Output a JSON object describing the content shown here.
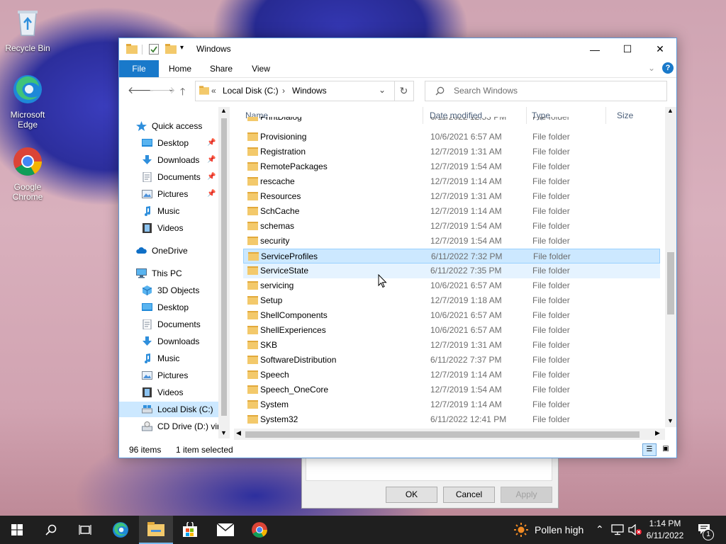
{
  "desktop": {
    "icons": [
      {
        "label": "Recycle Bin"
      },
      {
        "label": "Microsoft Edge"
      },
      {
        "label": "Google Chrome"
      }
    ]
  },
  "dialog": {
    "ok_label": "OK",
    "cancel_label": "Cancel",
    "apply_label": "Apply"
  },
  "window": {
    "title": "Windows",
    "controls": {
      "minimize": "—",
      "maximize": "☐",
      "close": "✕"
    }
  },
  "ribbon": {
    "tabs": [
      "File",
      "Home",
      "Share",
      "View"
    ],
    "help": "?"
  },
  "address": {
    "overflow": "«",
    "crumbs": [
      "Local Disk (C:)",
      "Windows"
    ],
    "separator": "›"
  },
  "search": {
    "placeholder": "Search Windows"
  },
  "sidebar": {
    "items": [
      {
        "label": "Quick access",
        "icon": "star-icon"
      },
      {
        "label": "Desktop",
        "icon": "desktop-icon"
      },
      {
        "label": "Downloads",
        "icon": "download-icon"
      },
      {
        "label": "Documents",
        "icon": "document-icon"
      },
      {
        "label": "Pictures",
        "icon": "picture-icon"
      },
      {
        "label": "Music",
        "icon": "music-icon"
      },
      {
        "label": "Videos",
        "icon": "video-icon"
      },
      {
        "label": "OneDrive",
        "icon": "cloud-icon"
      },
      {
        "label": "This PC",
        "icon": "computer-icon"
      },
      {
        "label": "3D Objects",
        "icon": "cube-icon"
      },
      {
        "label": "Desktop",
        "icon": "desktop-icon"
      },
      {
        "label": "Documents",
        "icon": "document-icon"
      },
      {
        "label": "Downloads",
        "icon": "download-icon"
      },
      {
        "label": "Music",
        "icon": "music-icon"
      },
      {
        "label": "Pictures",
        "icon": "picture-icon"
      },
      {
        "label": "Videos",
        "icon": "video-icon"
      },
      {
        "label": "Local Disk (C:)",
        "icon": "drive-icon"
      },
      {
        "label": "CD Drive (D:) virt",
        "icon": "cd-drive-icon"
      }
    ]
  },
  "columns": [
    "Name",
    "Date modified",
    "Type",
    "Size"
  ],
  "files": [
    {
      "name": "PrintDialog",
      "date": "6/11/2022 12:53 PM",
      "type": "File folder"
    },
    {
      "name": "Provisioning",
      "date": "10/6/2021 6:57 AM",
      "type": "File folder"
    },
    {
      "name": "Registration",
      "date": "12/7/2019 1:31 AM",
      "type": "File folder"
    },
    {
      "name": "RemotePackages",
      "date": "12/7/2019 1:54 AM",
      "type": "File folder"
    },
    {
      "name": "rescache",
      "date": "12/7/2019 1:14 AM",
      "type": "File folder"
    },
    {
      "name": "Resources",
      "date": "12/7/2019 1:31 AM",
      "type": "File folder"
    },
    {
      "name": "SchCache",
      "date": "12/7/2019 1:14 AM",
      "type": "File folder"
    },
    {
      "name": "schemas",
      "date": "12/7/2019 1:54 AM",
      "type": "File folder"
    },
    {
      "name": "security",
      "date": "12/7/2019 1:54 AM",
      "type": "File folder"
    },
    {
      "name": "ServiceProfiles",
      "date": "6/11/2022 7:32 PM",
      "type": "File folder"
    },
    {
      "name": "ServiceState",
      "date": "6/11/2022 7:35 PM",
      "type": "File folder"
    },
    {
      "name": "servicing",
      "date": "10/6/2021 6:57 AM",
      "type": "File folder"
    },
    {
      "name": "Setup",
      "date": "12/7/2019 1:18 AM",
      "type": "File folder"
    },
    {
      "name": "ShellComponents",
      "date": "10/6/2021 6:57 AM",
      "type": "File folder"
    },
    {
      "name": "ShellExperiences",
      "date": "10/6/2021 6:57 AM",
      "type": "File folder"
    },
    {
      "name": "SKB",
      "date": "12/7/2019 1:31 AM",
      "type": "File folder"
    },
    {
      "name": "SoftwareDistribution",
      "date": "6/11/2022 7:37 PM",
      "type": "File folder"
    },
    {
      "name": "Speech",
      "date": "12/7/2019 1:14 AM",
      "type": "File folder"
    },
    {
      "name": "Speech_OneCore",
      "date": "12/7/2019 1:54 AM",
      "type": "File folder"
    },
    {
      "name": "System",
      "date": "12/7/2019 1:14 AM",
      "type": "File folder"
    },
    {
      "name": "System32",
      "date": "6/11/2022 12:41 PM",
      "type": "File folder"
    }
  ],
  "status": {
    "count": "96 items",
    "selected": "1 item selected"
  },
  "taskbar": {
    "weather": "Pollen high",
    "time": "1:14 PM",
    "date": "6/11/2022",
    "notifications": "1"
  },
  "colors": {
    "accent": "#1979ca",
    "selection": "#cce8ff",
    "taskbar": "#1f1f1f",
    "folder": "#f3c96b"
  }
}
